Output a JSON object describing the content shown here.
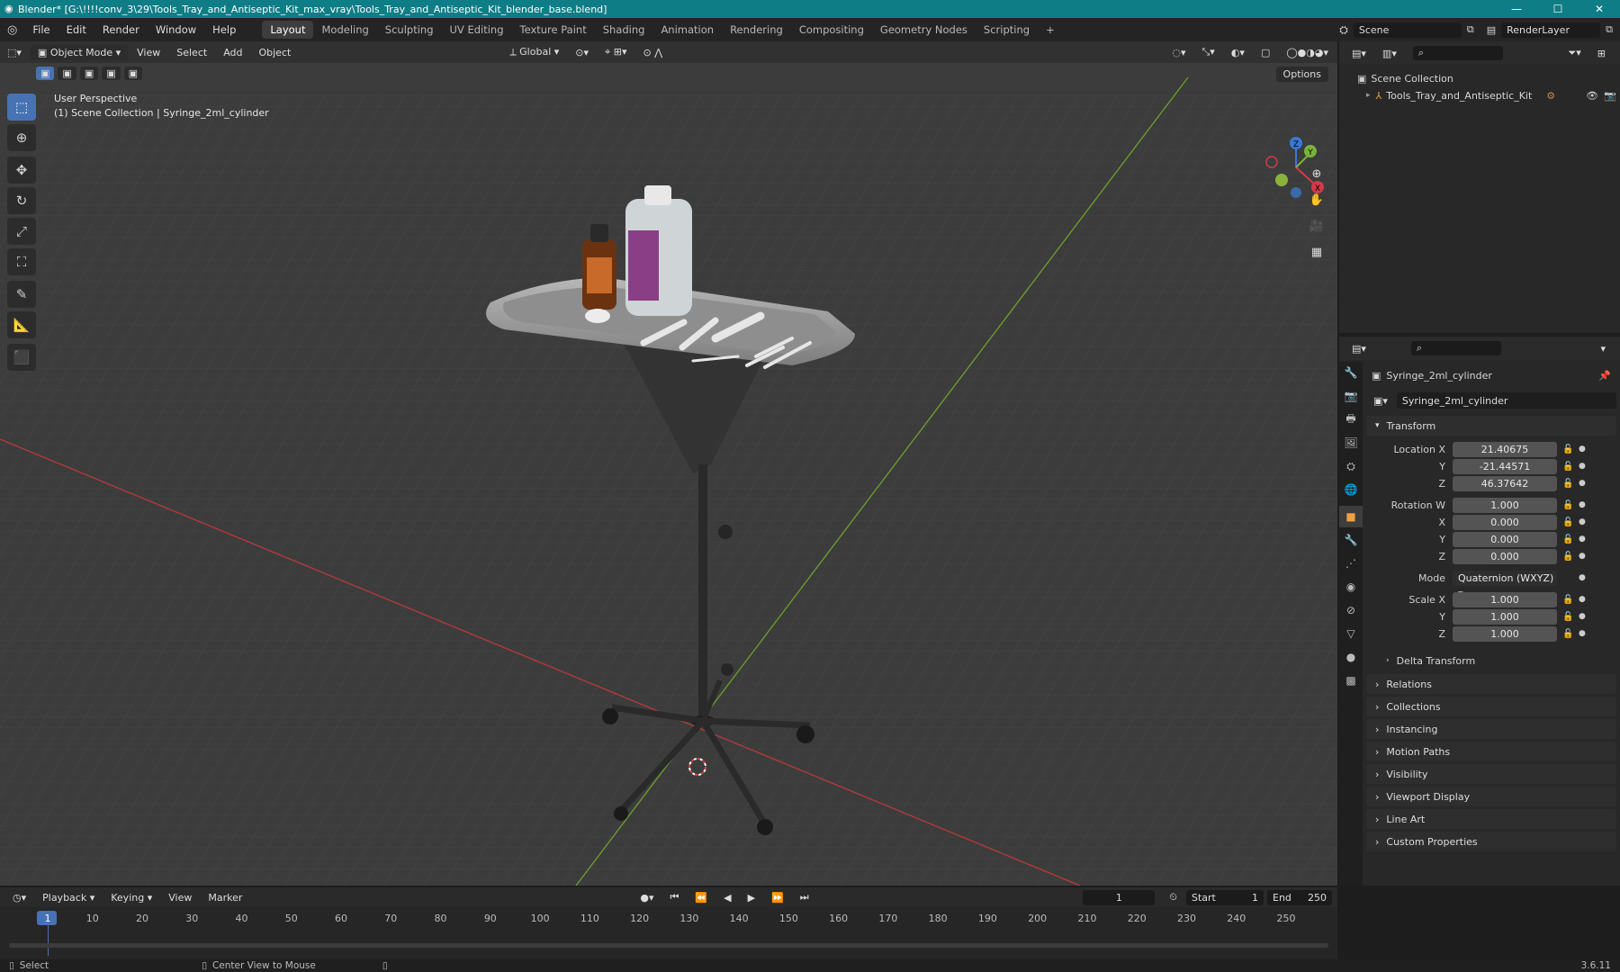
{
  "window": {
    "title": "Blender* [G:\\!!!!conv_3\\29\\Tools_Tray_and_Antiseptic_Kit_max_vray\\Tools_Tray_and_Antiseptic_Kit_blender_base.blend]",
    "min": "—",
    "max": "☐",
    "close": "✕"
  },
  "menu": [
    "File",
    "Edit",
    "Render",
    "Window",
    "Help"
  ],
  "workspaces": [
    "Layout",
    "Modeling",
    "Sculpting",
    "UV Editing",
    "Texture Paint",
    "Shading",
    "Animation",
    "Rendering",
    "Compositing",
    "Geometry Nodes",
    "Scripting"
  ],
  "active_workspace": "Layout",
  "add_workspace": "+",
  "scene": "Scene",
  "view_layer": "RenderLayer",
  "viewport": {
    "mode": "Object Mode",
    "menus": [
      "View",
      "Select",
      "Add",
      "Object"
    ],
    "orientation": "Global",
    "options": "Options",
    "info_line1": "User Perspective",
    "info_line2": "(1) Scene Collection | Syringe_2ml_cylinder",
    "gizmo": {
      "x": "X",
      "y": "Y",
      "z": "Z"
    }
  },
  "outliner": {
    "root": "Scene Collection",
    "item": "Tools_Tray_and_Antiseptic_Kit"
  },
  "properties": {
    "object_name": "Syringe_2ml_cylinder",
    "data_name": "Syringe_2ml_cylinder",
    "transform_label": "Transform",
    "location": {
      "label": "Location X",
      "x": "21.40675",
      "y": "-21.44571",
      "z": "46.37642"
    },
    "rotation": {
      "label": "Rotation W",
      "w": "1.000",
      "x": "0.000",
      "y": "0.000",
      "z": "0.000"
    },
    "mode_label": "Mode",
    "mode": "Quaternion (WXYZ)",
    "scale": {
      "label": "Scale X",
      "x": "1.000",
      "y": "1.000",
      "z": "1.000"
    },
    "axis_y": "Y",
    "axis_z": "Z",
    "axis_x": "X",
    "delta": "Delta Transform",
    "sections": [
      "Relations",
      "Collections",
      "Instancing",
      "Motion Paths",
      "Visibility",
      "Viewport Display",
      "Line Art",
      "Custom Properties"
    ]
  },
  "timeline": {
    "menus": [
      "Playback",
      "Keying",
      "View",
      "Marker"
    ],
    "current_frame": "1",
    "start_label": "Start",
    "start": "1",
    "end_label": "End",
    "end": "250",
    "ticks": [
      "1",
      "10",
      "20",
      "30",
      "40",
      "50",
      "60",
      "70",
      "80",
      "90",
      "100",
      "110",
      "120",
      "130",
      "140",
      "150",
      "160",
      "170",
      "180",
      "190",
      "200",
      "210",
      "220",
      "230",
      "240",
      "250"
    ]
  },
  "status": {
    "select": "Select",
    "center": "Center View to Mouse",
    "version": "3.6.11"
  }
}
